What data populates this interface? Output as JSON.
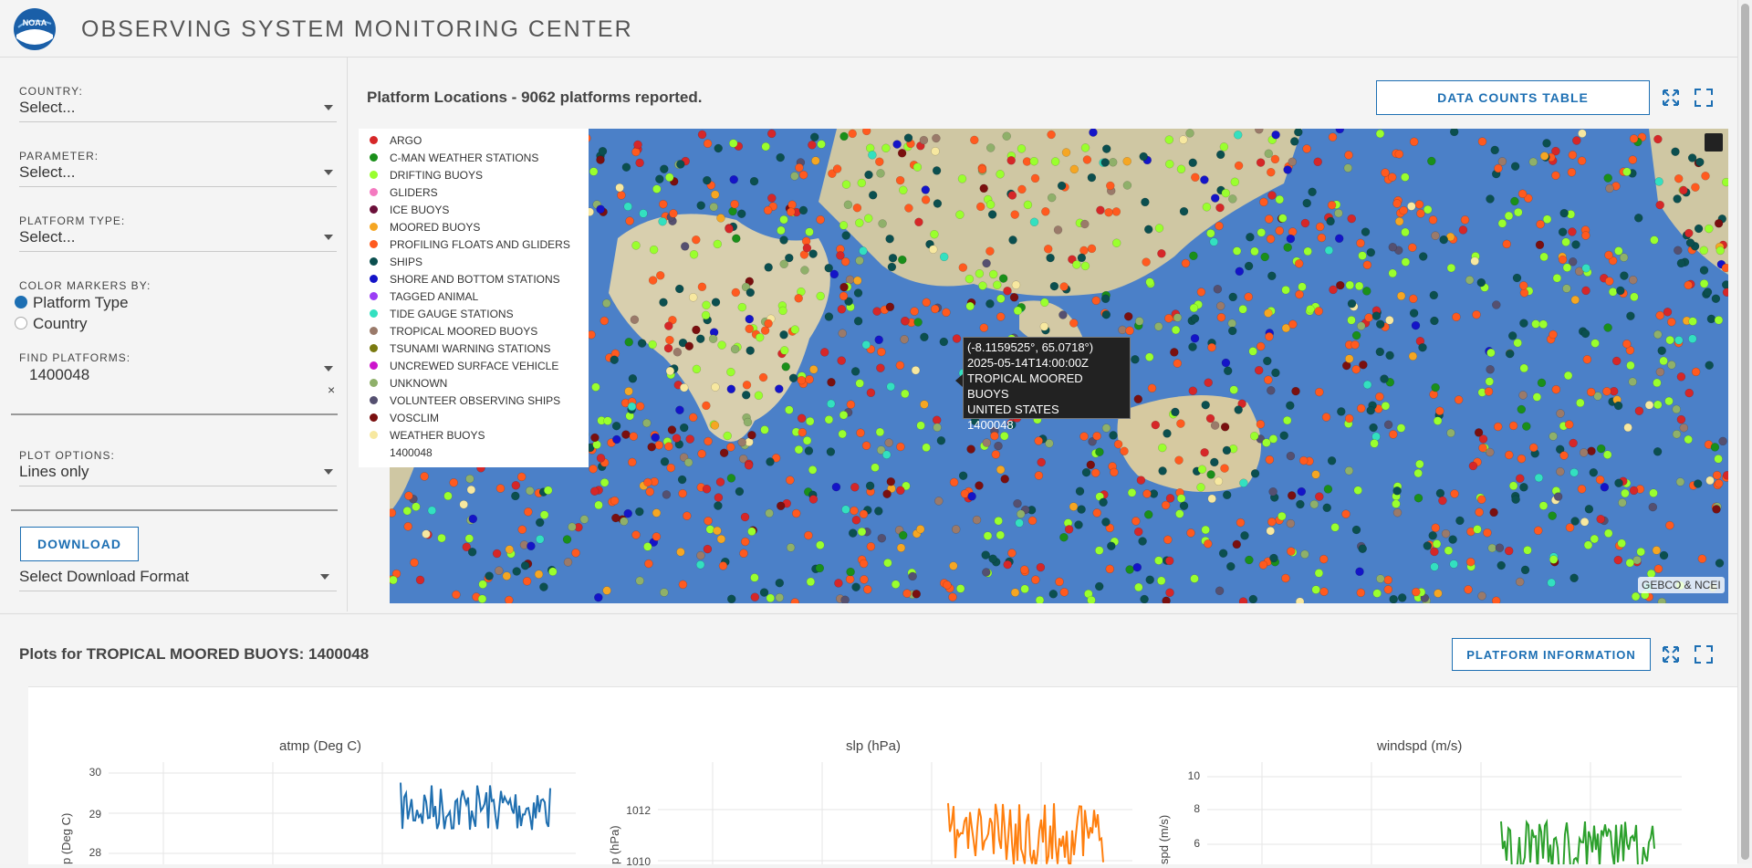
{
  "header": {
    "title": "OBSERVING SYSTEM MONITORING CENTER",
    "logo_text": "NOAA"
  },
  "sidebar": {
    "country": {
      "label": "COUNTRY:",
      "value": "Select..."
    },
    "parameter": {
      "label": "PARAMETER:",
      "value": "Select..."
    },
    "platform_type": {
      "label": "PLATFORM TYPE:",
      "value": "Select..."
    },
    "color_markers": {
      "label": "COLOR MARKERS BY:",
      "options": [
        "Platform Type",
        "Country"
      ],
      "selected": "Platform Type"
    },
    "find_platforms": {
      "label": "FIND PLATFORMS:",
      "value": "1400048",
      "clear": "×"
    },
    "plot_options": {
      "label": "PLOT OPTIONS:",
      "value": "Lines only"
    },
    "download": {
      "button": "DOWNLOAD",
      "format_placeholder": "Select Download Format"
    }
  },
  "map_panel": {
    "title": "Platform Locations - 9062 platforms reported.",
    "data_counts_button": "DATA COUNTS TABLE",
    "attribution": "GEBCO & NCEI",
    "legend": [
      {
        "label": "ARGO",
        "color": "#d62728"
      },
      {
        "label": "C-MAN WEATHER STATIONS",
        "color": "#1a8f1a"
      },
      {
        "label": "DRIFTING BUOYS",
        "color": "#9aff2e"
      },
      {
        "label": "GLIDERS",
        "color": "#f47ac0"
      },
      {
        "label": "ICE BUOYS",
        "color": "#6b0f3a"
      },
      {
        "label": "MOORED BUOYS",
        "color": "#f5a623"
      },
      {
        "label": "PROFILING FLOATS AND GLIDERS",
        "color": "#ff5a1f"
      },
      {
        "label": "SHIPS",
        "color": "#0b4f4f"
      },
      {
        "label": "SHORE AND BOTTOM STATIONS",
        "color": "#1414c8"
      },
      {
        "label": "TAGGED ANIMAL",
        "color": "#9b3df5"
      },
      {
        "label": "TIDE GAUGE STATIONS",
        "color": "#33e0c0"
      },
      {
        "label": "TROPICAL MOORED BUOYS",
        "color": "#9a7a6a"
      },
      {
        "label": "TSUNAMI WARNING STATIONS",
        "color": "#7a7a10"
      },
      {
        "label": "UNCREWED SURFACE VEHICLE",
        "color": "#cc14cc"
      },
      {
        "label": "UNKNOWN",
        "color": "#8fb06a"
      },
      {
        "label": "VOLUNTEER OBSERVING SHIPS",
        "color": "#555070"
      },
      {
        "label": "VOSCLIM",
        "color": "#7a0f0f"
      },
      {
        "label": "WEATHER BUOYS",
        "color": "#f7e8a0"
      },
      {
        "label": "1400048",
        "color": ""
      }
    ],
    "tooltip": {
      "coords": "(-8.1159525°, 65.0718°)",
      "time": "2025-05-14T14:00:00Z",
      "type": "TROPICAL MOORED BUOYS",
      "country": "UNITED STATES",
      "id": "1400048"
    }
  },
  "plots_panel": {
    "title": "Plots for TROPICAL MOORED BUOYS: 1400048",
    "platform_info_button": "PLATFORM INFORMATION",
    "plots": [
      {
        "title": "atmp (Deg C)",
        "ylabel": "p (Deg C)",
        "yticks": [
          "30",
          "29",
          "28"
        ],
        "color": "#1f6fb0"
      },
      {
        "title": "slp (hPa)",
        "ylabel": "p (hPa)",
        "yticks": [
          "1012",
          "1010"
        ],
        "color": "#ff7f0e"
      },
      {
        "title": "windspd (m/s)",
        "ylabel": "spd (m/s)",
        "yticks": [
          "10",
          "8",
          "6"
        ],
        "color": "#2ca02c"
      }
    ]
  }
}
